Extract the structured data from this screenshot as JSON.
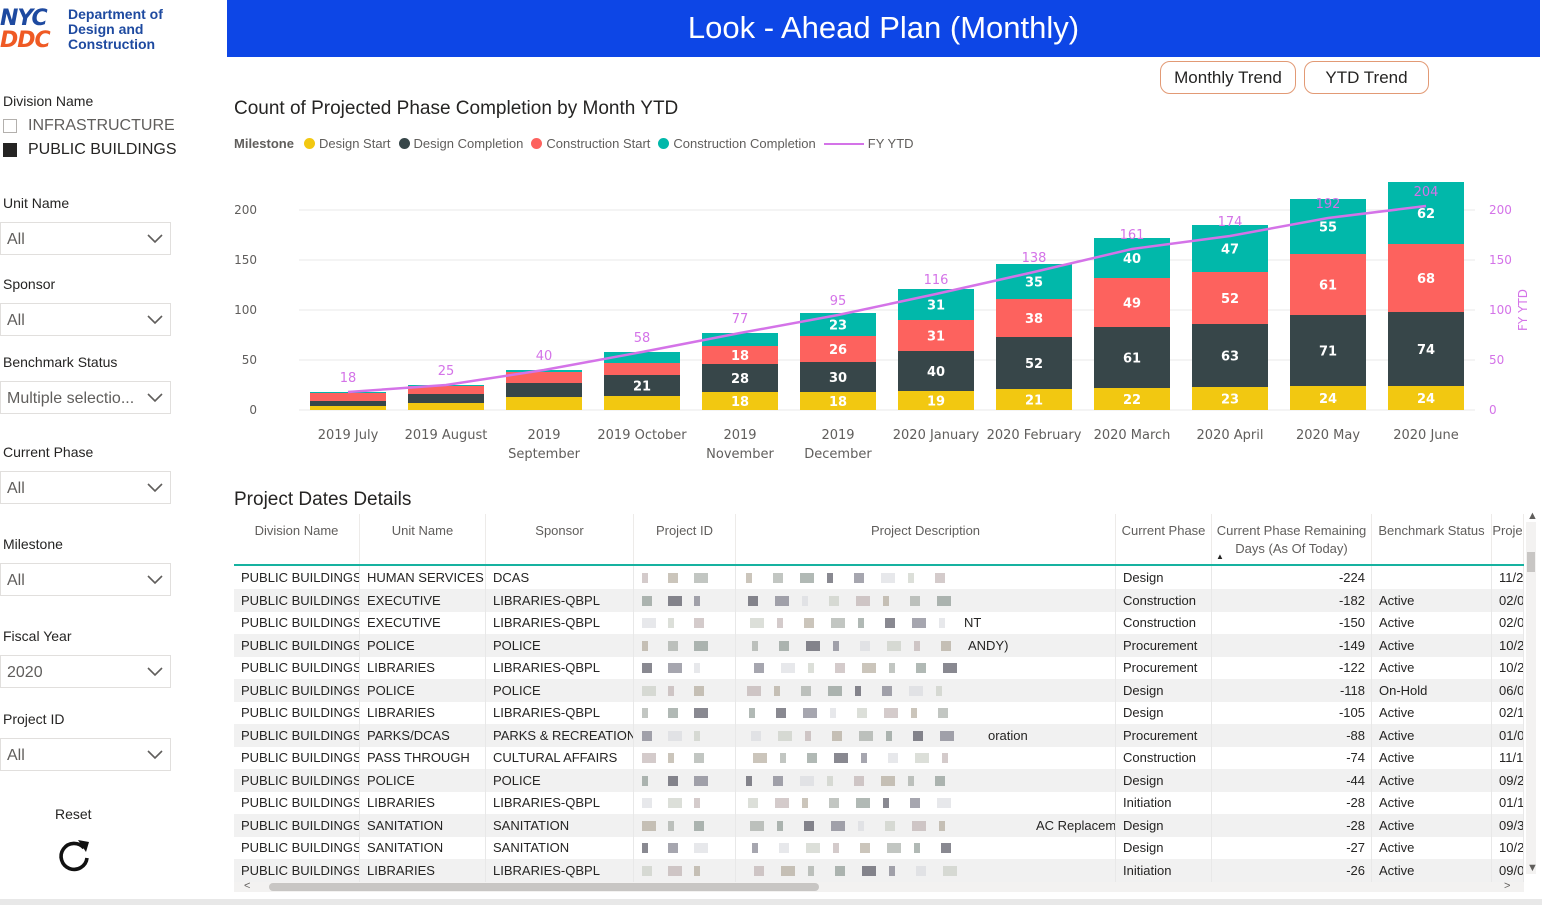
{
  "logo": {
    "mark_line1": "NYC",
    "mark_line2": "DDC",
    "line1": "Department of",
    "line2": "Design and",
    "line3": "Construction"
  },
  "header": {
    "title": "Look - Ahead Plan (Monthly)"
  },
  "buttons": {
    "monthly_trend": "Monthly Trend",
    "ytd_trend": "YTD Trend"
  },
  "filters": {
    "division": {
      "label": "Division Name",
      "options": [
        {
          "label": "INFRASTRUCTURE",
          "checked": false
        },
        {
          "label": "PUBLIC BUILDINGS",
          "checked": true
        }
      ]
    },
    "unit": {
      "label": "Unit Name",
      "value": "All"
    },
    "sponsor": {
      "label": "Sponsor",
      "value": "All"
    },
    "benchmark": {
      "label": "Benchmark Status",
      "value": "Multiple selectio..."
    },
    "phase": {
      "label": "Current Phase",
      "value": "All"
    },
    "milestone": {
      "label": "Milestone",
      "value": "All"
    },
    "fiscal_year": {
      "label": "Fiscal Year",
      "value": "2020"
    },
    "project_id": {
      "label": "Project ID",
      "value": "All"
    },
    "reset": {
      "label": "Reset"
    }
  },
  "colors": {
    "design_start": "#f2c811",
    "design_completion": "#374649",
    "construction_start": "#fd625e",
    "construction_completion": "#01b8aa",
    "fy_ytd": "#d473e8",
    "header": "#0d46e6"
  },
  "chart_data": {
    "type": "bar",
    "stacked": true,
    "title": "Count of Projected Phase Completion by Month YTD",
    "legend_title": "Milestone",
    "legend_position": "top-left",
    "categories": [
      "2019 July",
      "2019 August",
      "2019 September",
      "2019 October",
      "2019 November",
      "2019 December",
      "2020 January",
      "2020 February",
      "2020 March",
      "2020 April",
      "2020 May",
      "2020 June"
    ],
    "series": [
      {
        "name": "Design Start",
        "values": [
          4,
          7,
          13,
          14,
          18,
          18,
          19,
          21,
          22,
          23,
          24,
          24
        ],
        "labels": [
          null,
          null,
          null,
          null,
          "18",
          "18",
          "19",
          "21",
          "22",
          "23",
          "24",
          "24"
        ]
      },
      {
        "name": "Design Completion",
        "values": [
          5,
          9,
          14,
          21,
          28,
          30,
          40,
          52,
          61,
          63,
          71,
          74
        ],
        "labels": [
          null,
          null,
          null,
          "21",
          "28",
          "30",
          "40",
          "52",
          "61",
          "63",
          "71",
          "74"
        ]
      },
      {
        "name": "Construction Start",
        "values": [
          8,
          8,
          11,
          12,
          18,
          26,
          31,
          38,
          49,
          52,
          61,
          68
        ],
        "labels": [
          null,
          null,
          null,
          null,
          "18",
          "26",
          "31",
          "38",
          "49",
          "52",
          "61",
          "68"
        ]
      },
      {
        "name": "Construction Completion",
        "values": [
          1,
          1,
          2,
          11,
          13,
          23,
          31,
          35,
          40,
          47,
          55,
          62
        ],
        "labels": [
          null,
          null,
          null,
          null,
          null,
          "23",
          "31",
          "35",
          "40",
          "47",
          "55",
          "62"
        ]
      }
    ],
    "line_series": {
      "name": "FY YTD",
      "values": [
        18,
        25,
        40,
        58,
        77,
        95,
        116,
        138,
        161,
        174,
        192,
        204
      ],
      "axis": "right"
    },
    "y_left": {
      "min": 0,
      "max": 200,
      "ticks": [
        "0",
        "50",
        "100",
        "150",
        "200"
      ]
    },
    "y_right": {
      "label": "FY YTD",
      "min": 0,
      "max": 200,
      "ticks": [
        "0",
        "50",
        "100",
        "150",
        "200"
      ]
    },
    "grid": true
  },
  "table": {
    "title": "Project Dates Details",
    "columns": [
      "Division Name",
      "Unit Name",
      "Sponsor",
      "Project ID",
      "Project Description",
      "Current Phase",
      "Current Phase Remaining Days (As Of Today)",
      "Benchmark Status",
      "Proje"
    ],
    "rows": [
      [
        "PUBLIC BUILDINGS",
        "HUMAN SERVICES",
        "DCAS",
        "",
        "",
        "Design",
        "-224",
        "",
        "11/2"
      ],
      [
        "PUBLIC BUILDINGS",
        "EXECUTIVE",
        "LIBRARIES-QBPL",
        "",
        "",
        "Construction",
        "-182",
        "Active",
        "02/0"
      ],
      [
        "PUBLIC BUILDINGS",
        "EXECUTIVE",
        "LIBRARIES-QBPL",
        "",
        "NT",
        "Construction",
        "-150",
        "Active",
        "02/0"
      ],
      [
        "PUBLIC BUILDINGS",
        "POLICE",
        "POLICE",
        "",
        "ANDY)",
        "Procurement",
        "-149",
        "Active",
        "10/2"
      ],
      [
        "PUBLIC BUILDINGS",
        "LIBRARIES",
        "LIBRARIES-QBPL",
        "",
        "",
        "Procurement",
        "-122",
        "Active",
        "10/2"
      ],
      [
        "PUBLIC BUILDINGS",
        "POLICE",
        "POLICE",
        "",
        "",
        "Design",
        "-118",
        "On-Hold",
        "06/0"
      ],
      [
        "PUBLIC BUILDINGS",
        "LIBRARIES",
        "LIBRARIES-QBPL",
        "",
        "",
        "Design",
        "-105",
        "Active",
        "02/1"
      ],
      [
        "PUBLIC BUILDINGS",
        "PARKS/DCAS",
        "PARKS & RECREATION",
        "",
        "oration",
        "Procurement",
        "-88",
        "Active",
        "01/0"
      ],
      [
        "PUBLIC BUILDINGS",
        "PASS THROUGH",
        "CULTURAL AFFAIRS",
        "",
        "",
        "Construction",
        "-74",
        "Active",
        "11/1"
      ],
      [
        "PUBLIC BUILDINGS",
        "POLICE",
        "POLICE",
        "",
        "",
        "Design",
        "-44",
        "Active",
        "09/2"
      ],
      [
        "PUBLIC BUILDINGS",
        "LIBRARIES",
        "LIBRARIES-QBPL",
        "",
        "",
        "Initiation",
        "-28",
        "Active",
        "01/1"
      ],
      [
        "PUBLIC BUILDINGS",
        "SANITATION",
        "SANITATION",
        "",
        "AC Replacement",
        "Design",
        "-28",
        "Active",
        "09/3"
      ],
      [
        "PUBLIC BUILDINGS",
        "SANITATION",
        "SANITATION",
        "",
        "",
        "Design",
        "-27",
        "Active",
        "10/2"
      ],
      [
        "PUBLIC BUILDINGS",
        "LIBRARIES",
        "LIBRARIES-QBPL",
        "",
        "",
        "Initiation",
        "-26",
        "Active",
        "09/0"
      ]
    ]
  }
}
